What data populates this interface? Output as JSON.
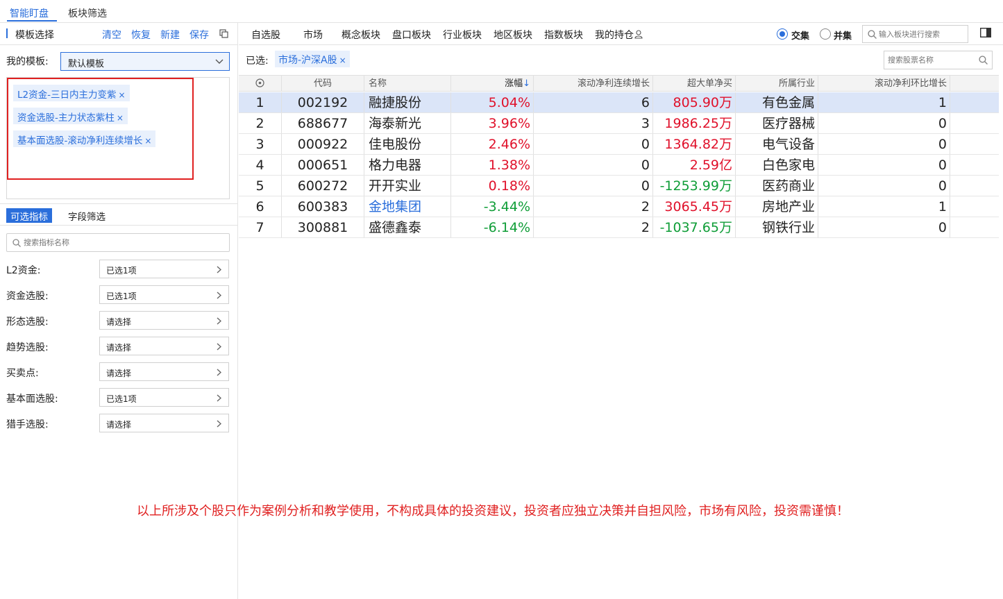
{
  "top_tabs": [
    {
      "label": "智能盯盘",
      "active": true
    },
    {
      "label": "板块筛选",
      "active": false
    }
  ],
  "template_panel": {
    "title": "模板选择",
    "actions": {
      "clear": "清空",
      "restore": "恢复",
      "new": "新建",
      "save": "保存"
    },
    "my_template_label": "我的模板:",
    "my_template_value": "默认模板",
    "tags": [
      "L2资金-三日内主力变紫",
      "资金选股-主力状态紫柱",
      "基本面选股-滚动净利连续增长"
    ],
    "tag_close": "×"
  },
  "indicator_tabs": {
    "active": "可选指标",
    "other": "字段筛选"
  },
  "indicator_search_placeholder": "搜索指标名称",
  "filters": [
    {
      "label": "L2资金:",
      "value": "已选1项"
    },
    {
      "label": "资金选股:",
      "value": "已选1项"
    },
    {
      "label": "形态选股:",
      "value": "请选择"
    },
    {
      "label": "趋势选股:",
      "value": "请选择"
    },
    {
      "label": "买卖点:",
      "value": "请选择"
    },
    {
      "label": "基本面选股:",
      "value": "已选1项"
    },
    {
      "label": "猎手选股:",
      "value": "请选择"
    }
  ],
  "nav": {
    "items": [
      "自选股",
      "市场",
      "概念板块",
      "盘口板块",
      "行业板块",
      "地区板块",
      "指数板块",
      "我的持仓"
    ],
    "mode_intersect": "交集",
    "mode_union": "并集",
    "mode_selected": "交集",
    "sector_search_placeholder": "输入板块进行搜索"
  },
  "selection": {
    "label": "已选:",
    "chip": "市场-沪深A股",
    "chip_close": "×",
    "stock_search_placeholder": "搜索股票名称"
  },
  "table": {
    "headers": {
      "code": "代码",
      "name": "名称",
      "change": "涨幅",
      "rolling_growth": "滚动净利连续增长",
      "big_net_buy": "超大单净买",
      "industry": "所属行业",
      "qoq_growth": "滚动净利环比增长"
    },
    "sort_arrow": "↓",
    "rows": [
      {
        "idx": "1",
        "code": "002192",
        "name": "融捷股份",
        "change": "5.04%",
        "rolling": "6",
        "big": "805.90万",
        "industry": "有色金属",
        "qoq": "1"
      },
      {
        "idx": "2",
        "code": "688677",
        "name": "海泰新光",
        "change": "3.96%",
        "rolling": "3",
        "big": "1986.25万",
        "industry": "医疗器械",
        "qoq": "0"
      },
      {
        "idx": "3",
        "code": "000922",
        "name": "佳电股份",
        "change": "2.46%",
        "rolling": "0",
        "big": "1364.82万",
        "industry": "电气设备",
        "qoq": "0"
      },
      {
        "idx": "4",
        "code": "000651",
        "name": "格力电器",
        "change": "1.38%",
        "rolling": "0",
        "big": "2.59亿",
        "industry": "白色家电",
        "qoq": "0"
      },
      {
        "idx": "5",
        "code": "600272",
        "name": "开开实业",
        "change": "0.18%",
        "rolling": "0",
        "big": "-1253.99万",
        "industry": "医药商业",
        "qoq": "0"
      },
      {
        "idx": "6",
        "code": "600383",
        "name": "金地集团",
        "change": "-3.44%",
        "rolling": "2",
        "big": "3065.45万",
        "industry": "房地产业",
        "qoq": "1"
      },
      {
        "idx": "7",
        "code": "300881",
        "name": "盛德鑫泰",
        "change": "-6.14%",
        "rolling": "2",
        "big": "-1037.65万",
        "industry": "钢铁行业",
        "qoq": "0"
      }
    ]
  },
  "disclaimer": "以上所涉及个股只作为案例分析和教学使用，不构成具体的投资建议，投资者应独立决策并自担风险，市场有风险，投资需谨慎！",
  "colors": {
    "accent": "#2a6edb",
    "up": "#e0102a",
    "down": "#0f9d37",
    "highlight_frame": "#e02020",
    "selected_row": "#dbe5f8"
  }
}
